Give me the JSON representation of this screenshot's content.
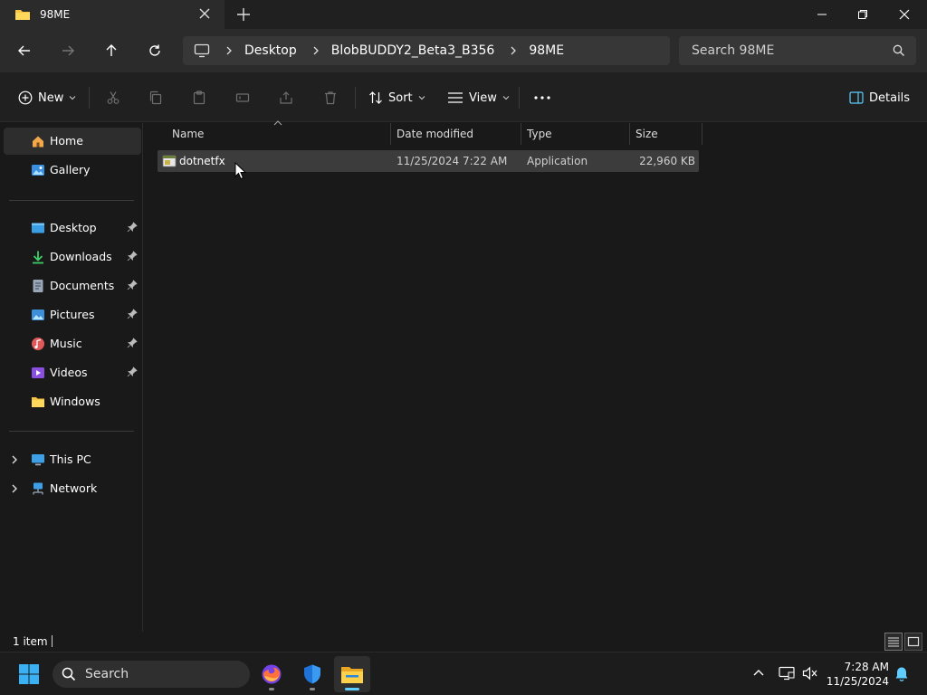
{
  "window": {
    "tab_title": "98ME"
  },
  "address": {
    "crumbs": [
      "Desktop",
      "BlobBUDDY2_Beta3_B356",
      "98ME"
    ]
  },
  "search": {
    "placeholder": "Search 98ME"
  },
  "commands": {
    "new_label": "New",
    "sort_label": "Sort",
    "view_label": "View",
    "details_label": "Details"
  },
  "sidebar": {
    "top": [
      {
        "label": "Home",
        "icon": "home-icon"
      },
      {
        "label": "Gallery",
        "icon": "gallery-icon"
      }
    ],
    "quick_access": [
      {
        "label": "Desktop",
        "icon": "desktop-folder-icon",
        "pinned": true
      },
      {
        "label": "Downloads",
        "icon": "download-icon",
        "pinned": true
      },
      {
        "label": "Documents",
        "icon": "documents-icon",
        "pinned": true
      },
      {
        "label": "Pictures",
        "icon": "pictures-icon",
        "pinned": true
      },
      {
        "label": "Music",
        "icon": "music-icon",
        "pinned": true
      },
      {
        "label": "Videos",
        "icon": "videos-icon",
        "pinned": true
      },
      {
        "label": "Windows",
        "icon": "folder-icon",
        "pinned": false
      }
    ],
    "tree": [
      {
        "label": "This PC",
        "icon": "computer-icon"
      },
      {
        "label": "Network",
        "icon": "network-icon"
      }
    ]
  },
  "file_list": {
    "columns": [
      "Name",
      "Date modified",
      "Type",
      "Size"
    ],
    "rows": [
      {
        "name": "dotnetfx",
        "date": "11/25/2024 7:22 AM",
        "type": "Application",
        "size": "22,960 KB"
      }
    ]
  },
  "status": {
    "count": "1 item"
  },
  "taskbar": {
    "search_label": "Search",
    "time": "7:28 AM",
    "date": "11/25/2024"
  },
  "colors": {
    "accent": "#60cdff",
    "folder": "#f6c342",
    "background": "#191919",
    "selection": "#3c3c3c"
  }
}
